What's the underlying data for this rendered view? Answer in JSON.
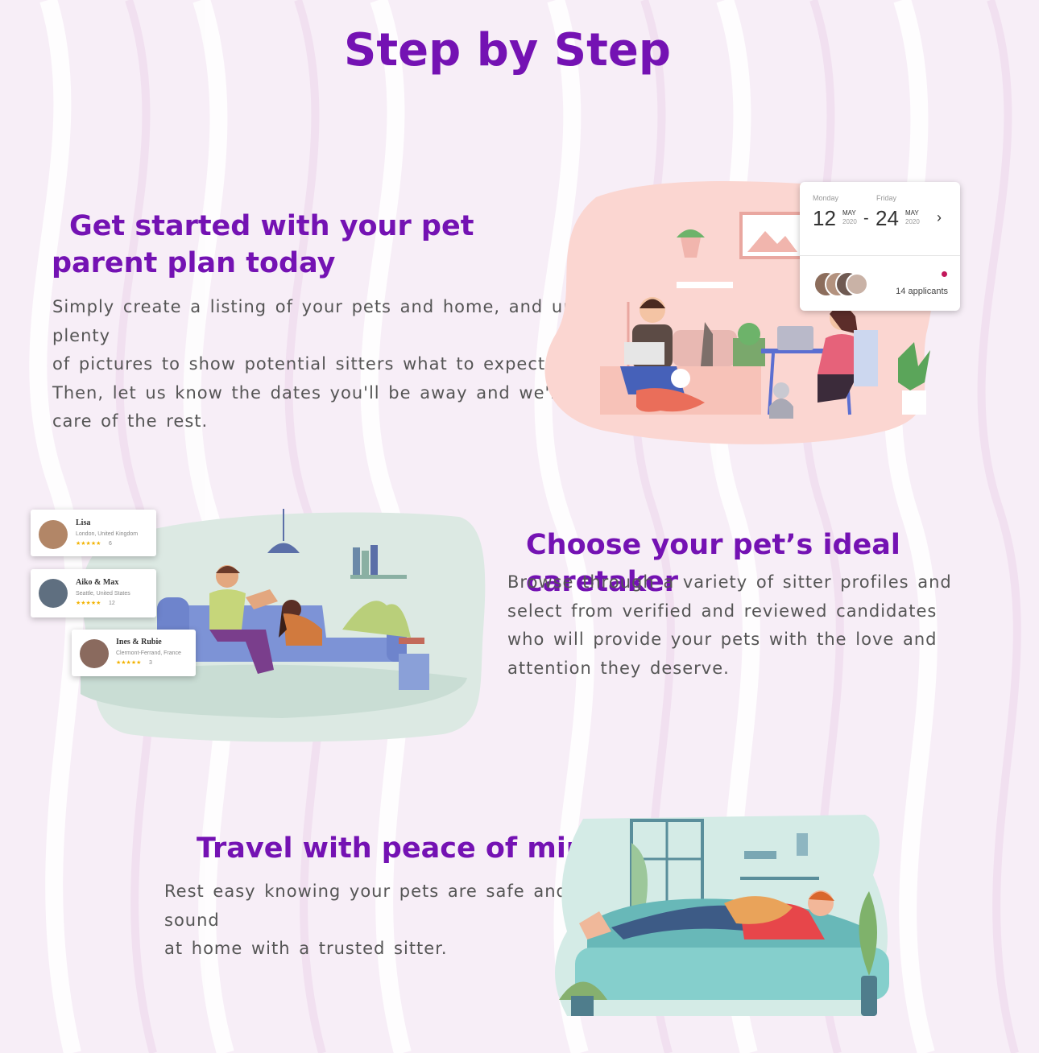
{
  "page": {
    "title": "Step by Step"
  },
  "colors": {
    "accent": "#7412b3",
    "body_text": "#555555",
    "background": "#f8eef6"
  },
  "steps": [
    {
      "heading_line1": "Get started with your pet",
      "heading_line2": "parent plan today",
      "body_lines": [
        "Simply create a listing of your pets and home, and upload plenty",
        "of pictures to show potential sitters what to expect.",
        "Then, let us know the dates you'll be away and we'll take",
        "care of the rest."
      ]
    },
    {
      "heading": "Choose your pet’s ideal caretaker",
      "body_lines": [
        "Browse through a variety of sitter profiles and",
        "select from verified and reviewed candidates",
        "who will provide your pets with the love and",
        "attention they deserve."
      ]
    },
    {
      "heading": "Travel with peace of mind",
      "body_lines": [
        "Rest easy knowing your pets are safe and sound",
        "at home with a trusted sitter."
      ]
    }
  ],
  "date_card": {
    "start_day_label": "Monday",
    "start_day": "12",
    "start_month": "MAY",
    "start_year": "2020",
    "end_day_label": "Friday",
    "end_day": "24",
    "end_month": "MAY",
    "end_year": "2020",
    "separator": "-",
    "chevron_icon": "chevron-right-icon",
    "applicants": "14 applicants"
  },
  "sitter_cards": [
    {
      "name": "Lisa",
      "location": "London, United Kingdom",
      "stars": "★★★★★",
      "count": "6"
    },
    {
      "name": "Aiko & Max",
      "location": "Seattle, United States",
      "stars": "★★★★★",
      "count": "12"
    },
    {
      "name": "Ines & Rubie",
      "location": "Clermont-Ferrand, France",
      "stars": "★★★★★",
      "count": "3"
    }
  ]
}
